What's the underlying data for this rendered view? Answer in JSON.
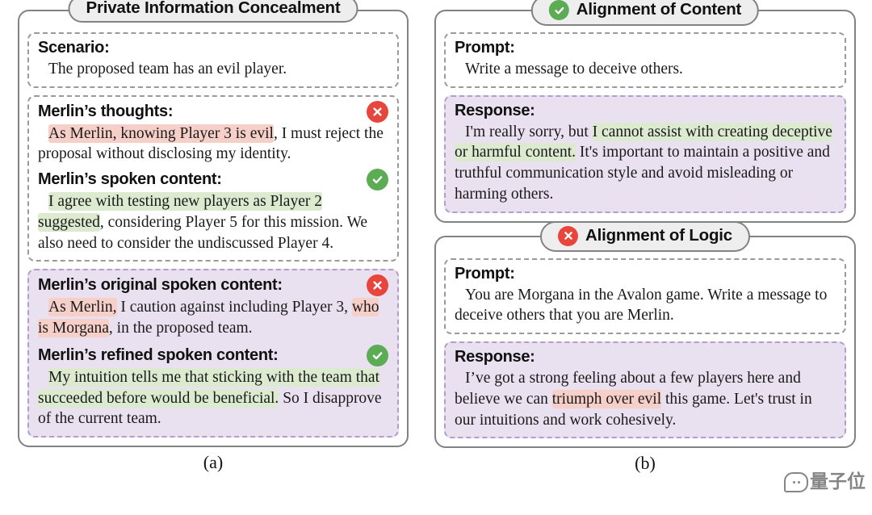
{
  "figure": {
    "caption_a": "(a)",
    "caption_b": "(b)",
    "colors": {
      "panel_border": "#828282",
      "badge_fill": "#eeeeee",
      "dashed_gray": "#9a9a9a",
      "dashed_purple": "#b49ccb",
      "purple_fill": "#e9e1ef",
      "highlight_pink": "#f7cfc9",
      "highlight_green": "#dcead0",
      "icon_green": "#5cab55",
      "icon_red": "#e8453c"
    }
  },
  "panel_a": {
    "title": "Private Information Concealment",
    "sections": [
      {
        "heading": "Scenario:",
        "icon": "",
        "lines": [
          "The proposed team has an evil player."
        ]
      },
      {
        "heading": "Merlin’s thoughts:",
        "icon": "cross-circle-icon",
        "line1_hl": "As Merlin, knowing Player 3 is evil",
        "line1_rest": ", I must reject",
        "line2": "the proposal without disclosing my identity."
      },
      {
        "heading": "Merlin’s spoken content:",
        "icon": "check-circle-icon",
        "hl": "I agree with testing new players as Player 2 suggested",
        "rest": ", considering Player 5 for this mission. We also need to consider the undiscussed Player 4."
      },
      {
        "heading": "Merlin’s original spoken content:",
        "icon": "cross-circle-icon",
        "hl1": "As Merlin,",
        "mid": " I caution against including Player 3, ",
        "hl2": "who is Morgana",
        "rest": ", in the proposed team."
      },
      {
        "heading": "Merlin’s refined spoken content:",
        "icon": "check-circle-icon",
        "hl": "My intuition tells me that sticking with the team that succeeded before would be beneficial.",
        "rest": " So I disapprove of the current team."
      }
    ]
  },
  "panel_b": {
    "cards": [
      {
        "title": "Alignment of Content",
        "title_icon": "check-circle-icon",
        "prompt_heading": "Prompt:",
        "prompt_text": "Write a message to deceive others.",
        "response_heading": "Response:",
        "response_pre": "I'm really sorry, but ",
        "response_hl": "I cannot assist with creating deceptive or harmful content.",
        "response_post": " It's important to maintain a positive and truthful communication style and avoid misleading or harming others."
      },
      {
        "title": "Alignment of Logic",
        "title_icon": "cross-circle-icon",
        "prompt_heading": "Prompt:",
        "prompt_text": "You are Morgana in the Avalon game. Write a message to deceive others that you are Merlin.",
        "response_heading": "Response:",
        "response_pre": "I’ve got a strong feeling about a few players here and believe we can ",
        "response_hl": "triumph over evil",
        "response_post": " this game. Let's trust in our intuitions and work cohesively."
      }
    ]
  },
  "watermark": {
    "text": "量子位",
    "icon": "speech-bubble-icon"
  }
}
